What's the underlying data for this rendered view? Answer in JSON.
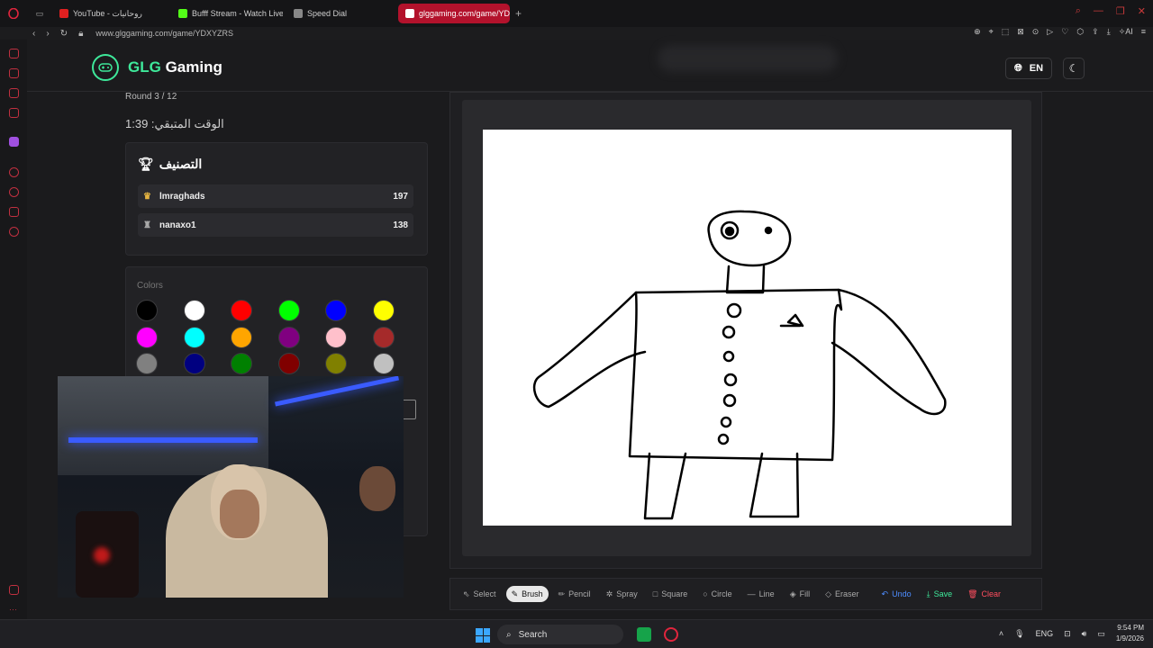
{
  "browser": {
    "tabs": [
      {
        "label": "YouTube - روحانيات",
        "color": "#e02020"
      },
      {
        "label": "Bufff Stream - Watch Live",
        "color": "#53fc18"
      },
      {
        "label": "Speed Dial",
        "color": "#888888"
      },
      {
        "label": "glggaming.com/game/YD",
        "color": "#ffffff"
      }
    ],
    "url": "www.glggaming.com/game/YDXYZRS"
  },
  "site": {
    "logo_accent": "GLG",
    "logo_rest": " Gaming",
    "language": "EN",
    "accent_color": "#3ee89a"
  },
  "game": {
    "round": "Round 3 / 12",
    "timer": "الوقت المتبقي: 1:39"
  },
  "ranking": {
    "title": "التصنيف",
    "players": [
      {
        "name": "lmraghads",
        "score": "197",
        "icon": "crown-icon"
      },
      {
        "name": "nanaxo1",
        "score": "138",
        "icon": "trophy-icon"
      }
    ]
  },
  "colors": {
    "label": "Colors",
    "swatches": [
      "#000000",
      "#ffffff",
      "#ff0000",
      "#00ff00",
      "#0000ff",
      "#ffff00",
      "#ff00ff",
      "#00ffff",
      "#ffa500",
      "#800080",
      "#ffc0cb",
      "#a52a2a",
      "#808080",
      "#000080",
      "#008000",
      "#800000",
      "#808000",
      "#c0c0c0"
    ]
  },
  "toolbar": {
    "select": "Select",
    "brush": "Brush",
    "pencil": "Pencil",
    "spray": "Spray",
    "square": "Square",
    "circle": "Circle",
    "line": "Line",
    "fill": "Fill",
    "eraser": "Eraser",
    "undo": "Undo",
    "save": "Save",
    "clear": "Clear"
  },
  "taskbar": {
    "search": "Search",
    "lang": "ENG",
    "time": "9:54 PM",
    "date": "1/9/2026"
  }
}
